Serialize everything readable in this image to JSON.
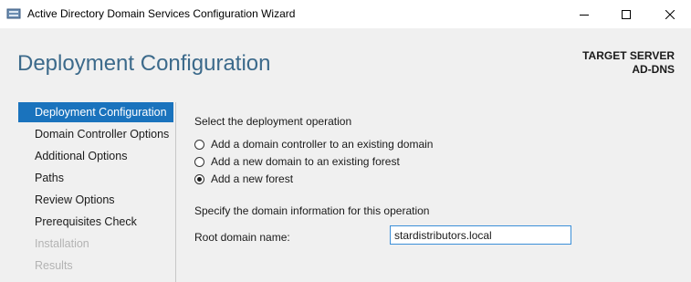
{
  "window": {
    "title": "Active Directory Domain Services Configuration Wizard",
    "icon": "server-wizard-icon",
    "controls": [
      "minimize-icon",
      "maximize-icon",
      "close-icon"
    ]
  },
  "header": {
    "page_title": "Deployment Configuration",
    "target_label": "TARGET SERVER",
    "target_name": "AD-DNS"
  },
  "sidebar": {
    "items": [
      {
        "label": "Deployment Configuration",
        "state": "active"
      },
      {
        "label": "Domain Controller Options",
        "state": "normal"
      },
      {
        "label": "Additional Options",
        "state": "normal"
      },
      {
        "label": "Paths",
        "state": "normal"
      },
      {
        "label": "Review Options",
        "state": "normal"
      },
      {
        "label": "Prerequisites Check",
        "state": "normal"
      },
      {
        "label": "Installation",
        "state": "disabled"
      },
      {
        "label": "Results",
        "state": "disabled"
      }
    ]
  },
  "main": {
    "operation_heading": "Select the deployment operation",
    "options": [
      {
        "label": "Add a domain controller to an existing domain",
        "checked": false
      },
      {
        "label": "Add a new domain to an existing forest",
        "checked": false
      },
      {
        "label": "Add a new forest",
        "checked": true
      }
    ],
    "domain_heading": "Specify the domain information for this operation",
    "root_domain_label": "Root domain name:",
    "root_domain_value": "stardistributors.local"
  },
  "colors": {
    "accent": "#1a73bd",
    "title": "#3c6a8b",
    "disabled": "#b3b3b3"
  }
}
